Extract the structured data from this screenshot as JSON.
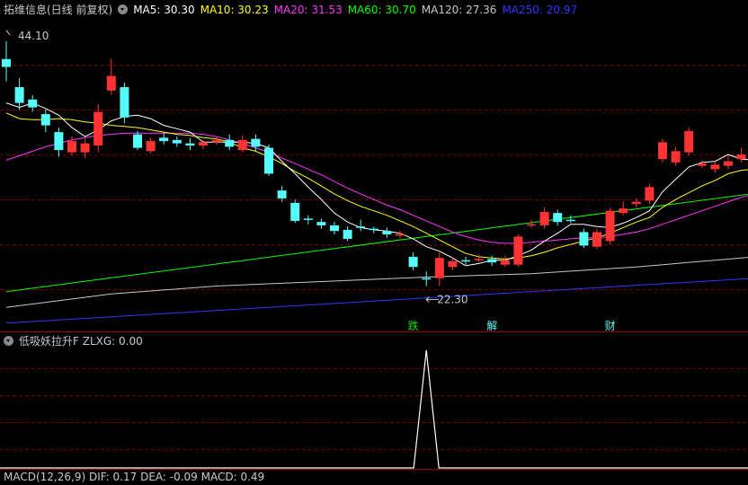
{
  "header": {
    "title": "拓维信息(日线 前复权)",
    "indicators": [
      {
        "label": "MA5: 30.30",
        "color": "#ffffff"
      },
      {
        "label": "MA10: 30.23",
        "color": "#ffff00"
      },
      {
        "label": "MA20: 31.53",
        "color": "#ff33ff"
      },
      {
        "label": "MA60: 30.70",
        "color": "#00ff00"
      },
      {
        "label": "MA120: 27.36",
        "color": "#c8c8c8"
      },
      {
        "label": "MA250: 20.97",
        "color": "#3333ff"
      }
    ]
  },
  "colors": {
    "up": "#ff3333",
    "down": "#54fcfc",
    "grid": "#7a0000",
    "divider": "#7a0000"
  },
  "chart_data": {
    "type": "candlestick",
    "ylim": [
      18.5,
      46
    ],
    "annotations": {
      "high_label": "44.10",
      "high_value": 44.1,
      "low_label": "22.30",
      "low_value": 22.3
    },
    "candles": [
      [
        42.5,
        41.8,
        44.1,
        40.5
      ],
      [
        40.0,
        38.6,
        40.8,
        38.0
      ],
      [
        38.9,
        38.2,
        39.3,
        37.8
      ],
      [
        37.6,
        36.6,
        38.0,
        36.0
      ],
      [
        36.0,
        34.4,
        36.4,
        33.8
      ],
      [
        34.2,
        35.2,
        35.6,
        33.9
      ],
      [
        34.2,
        35.0,
        35.4,
        33.7
      ],
      [
        34.8,
        37.8,
        38.5,
        34.2
      ],
      [
        39.7,
        41.0,
        42.5,
        39.3
      ],
      [
        40.0,
        37.3,
        40.4,
        36.8
      ],
      [
        35.8,
        34.6,
        36.1,
        34.4
      ],
      [
        34.3,
        35.2,
        35.5,
        34.1
      ],
      [
        35.5,
        35.2,
        35.9,
        34.9
      ],
      [
        35.3,
        35.0,
        35.6,
        34.7
      ],
      [
        35.0,
        34.8,
        35.5,
        34.4
      ],
      [
        34.8,
        35.1,
        35.3,
        34.5
      ],
      [
        35.1,
        35.3,
        35.6,
        34.9
      ],
      [
        35.3,
        34.7,
        35.8,
        34.4
      ],
      [
        34.4,
        35.3,
        35.7,
        34.2
      ],
      [
        35.4,
        34.7,
        35.8,
        34.3
      ],
      [
        34.6,
        32.3,
        34.9,
        32.1
      ],
      [
        30.8,
        30.1,
        31.2,
        29.8
      ],
      [
        29.7,
        28.1,
        30.0,
        27.9
      ],
      [
        28.3,
        28.2,
        28.6,
        27.8
      ],
      [
        28.0,
        27.7,
        28.3,
        27.4
      ],
      [
        27.7,
        27.2,
        28.0,
        26.9
      ],
      [
        27.3,
        26.5,
        27.6,
        26.3
      ],
      [
        27.6,
        27.5,
        28.2,
        27.2
      ],
      [
        27.4,
        27.3,
        27.6,
        27.0
      ],
      [
        27.2,
        26.9,
        27.5,
        26.6
      ],
      [
        26.9,
        26.9,
        27.2,
        26.5
      ],
      [
        24.9,
        24.0,
        25.3,
        23.7
      ],
      [
        23.0,
        22.9,
        23.6,
        22.3
      ],
      [
        23.0,
        24.8,
        25.3,
        22.3
      ],
      [
        24.0,
        24.5,
        24.8,
        23.7
      ],
      [
        24.6,
        24.5,
        24.9,
        24.2
      ],
      [
        24.7,
        24.7,
        25.1,
        24.4
      ],
      [
        24.7,
        24.4,
        25.0,
        24.1
      ],
      [
        24.2,
        24.6,
        25.0,
        24.0
      ],
      [
        24.2,
        26.7,
        26.9,
        24.0
      ],
      [
        27.7,
        27.8,
        28.2,
        27.5
      ],
      [
        27.7,
        28.9,
        29.3,
        27.4
      ],
      [
        28.8,
        28.0,
        29.1,
        27.7
      ],
      [
        28.2,
        28.1,
        28.6,
        27.9
      ],
      [
        27.1,
        25.9,
        27.4,
        25.7
      ],
      [
        25.8,
        27.1,
        27.4,
        25.6
      ],
      [
        26.3,
        29.0,
        29.3,
        26.0
      ],
      [
        28.8,
        29.2,
        29.8,
        28.6
      ],
      [
        29.6,
        29.8,
        30.1,
        29.3
      ],
      [
        29.9,
        31.1,
        31.4,
        29.6
      ],
      [
        33.6,
        35.1,
        35.4,
        33.3
      ],
      [
        33.3,
        34.3,
        34.7,
        33.0
      ],
      [
        34.2,
        36.1,
        36.4,
        33.9
      ],
      [
        33.0,
        33.2,
        33.5,
        32.8
      ],
      [
        32.7,
        33.1,
        33.4,
        32.4
      ],
      [
        33.0,
        33.4,
        33.9,
        32.7
      ],
      [
        33.6,
        34.0,
        34.6,
        33.3
      ],
      [
        34.0,
        33.8,
        34.3,
        33.6
      ],
      [
        33.0,
        31.6,
        33.4,
        31.3
      ],
      [
        32.5,
        31.6,
        32.8,
        31.3
      ],
      [
        31.8,
        32.2,
        32.6,
        31.5
      ]
    ],
    "ma5": [
      38.6,
      38.2,
      38.6,
      38.1,
      37.5,
      36.4,
      35.6,
      36.2,
      37.0,
      37.4,
      37.5,
      37.2,
      36.6,
      36.3,
      36.0,
      35.1,
      35.1,
      35.1,
      35.1,
      35.0,
      34.6,
      33.4,
      32.3,
      31.1,
      30.0,
      28.8,
      28.0,
      27.5,
      27.3,
      27.2,
      27.0,
      26.5,
      25.8,
      25.4,
      24.8,
      24.1,
      24.3,
      24.6,
      24.6,
      25.0,
      25.5,
      26.3,
      27.0,
      27.8,
      27.8,
      27.6,
      27.5,
      27.9,
      28.4,
      29.0,
      30.7,
      31.8,
      32.9,
      33.3,
      33.4,
      34.0,
      33.6,
      33.5,
      33.0,
      32.8,
      32.5
    ],
    "ma10": [
      37.7,
      37.2,
      37.1,
      37.1,
      37.2,
      37.1,
      36.9,
      36.8,
      36.6,
      36.5,
      36.4,
      36.2,
      36.0,
      35.8,
      35.7,
      35.5,
      35.4,
      35.1,
      34.6,
      34.3,
      33.8,
      33.2,
      32.5,
      31.9,
      31.2,
      30.5,
      29.9,
      29.4,
      29.0,
      28.6,
      28.1,
      27.6,
      27.0,
      26.4,
      25.8,
      25.2,
      24.9,
      24.8,
      24.7,
      24.8,
      25.0,
      25.3,
      25.7,
      26.0,
      26.3,
      26.6,
      27.0,
      27.5,
      28.0,
      28.4,
      29.3,
      30.0,
      30.6,
      31.2,
      31.7,
      32.3,
      32.6,
      32.7,
      32.6,
      32.5,
      32.5
    ],
    "ma20": [
      33.5,
      33.9,
      34.3,
      34.7,
      35.0,
      35.3,
      35.5,
      35.7,
      35.8,
      35.9,
      35.9,
      35.9,
      35.9,
      35.9,
      35.9,
      35.8,
      35.6,
      35.3,
      35.0,
      34.6,
      34.2,
      33.7,
      33.2,
      32.7,
      32.2,
      31.6,
      31.0,
      30.5,
      30.0,
      29.5,
      29.1,
      28.6,
      28.1,
      27.6,
      27.1,
      26.7,
      26.4,
      26.2,
      26.1,
      26.1,
      26.2,
      26.3,
      26.4,
      26.5,
      26.6,
      26.6,
      26.7,
      26.9,
      27.1,
      27.4,
      27.8,
      28.2,
      28.6,
      29.0,
      29.4,
      29.8,
      30.2,
      30.5,
      30.8,
      31.1,
      31.5
    ],
    "ma60": {
      "x": [
        0,
        60
      ],
      "y": [
        21.8,
        31.0
      ]
    },
    "ma120": {
      "x": [
        0,
        8,
        16,
        24,
        32,
        40,
        48,
        56,
        60
      ],
      "y": [
        20.4,
        21.6,
        22.3,
        22.7,
        23.1,
        23.4,
        24.0,
        24.8,
        25.2
      ]
    },
    "ma250": {
      "x": [
        0,
        60
      ],
      "y": [
        19.0,
        23.2
      ]
    }
  },
  "event_tags": [
    {
      "label": "跌",
      "index": 31,
      "color": "#00e000"
    },
    {
      "label": "解",
      "index": 37,
      "color": "#54fcfc"
    },
    {
      "label": "财",
      "index": 46,
      "color": "#54fcfc"
    }
  ],
  "sub_panel": {
    "title": "低吸妖拉升F ZLXG: 0.00",
    "spike_index": 32,
    "spike_value": 1
  },
  "bottom_strip": {
    "text": "MACD(12,26,9) DIF: 0.17 DEA: -0.09 MACD: 0.49"
  }
}
